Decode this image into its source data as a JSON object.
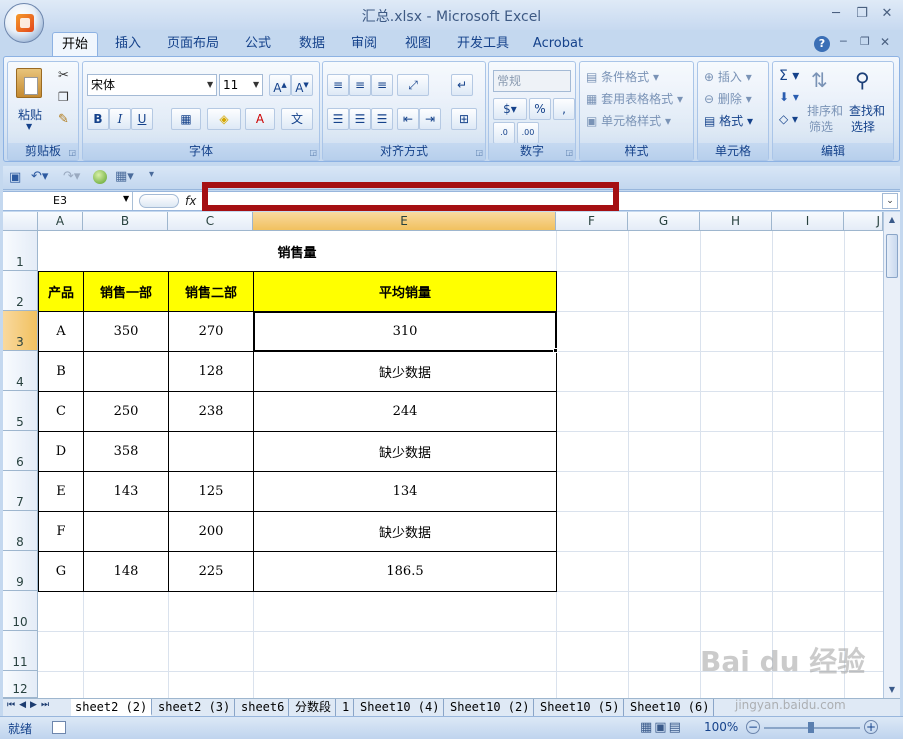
{
  "window": {
    "title": "汇总.xlsx - Microsoft Excel"
  },
  "tabs": [
    "开始",
    "插入",
    "页面布局",
    "公式",
    "数据",
    "审阅",
    "视图",
    "开发工具",
    "Acrobat"
  ],
  "ribbon": {
    "clipboard": {
      "label": "剪贴板",
      "paste": "粘贴"
    },
    "font": {
      "label": "字体",
      "name": "宋体",
      "size": "11"
    },
    "alignment": {
      "label": "对齐方式"
    },
    "number": {
      "label": "数字",
      "format": "常规"
    },
    "styles": {
      "label": "样式",
      "conditional": "条件格式",
      "table": "套用表格格式",
      "cell": "单元格样式"
    },
    "cells": {
      "label": "单元格",
      "insert": "插入",
      "delete": "删除",
      "format": "格式"
    },
    "editing": {
      "label": "编辑",
      "sort": "排序和",
      "filter": "筛选",
      "find": "查找和",
      "select": "选择"
    }
  },
  "formula_bar": {
    "name_box": "E3",
    "fx": "fx",
    "content": ""
  },
  "columns": [
    "A",
    "B",
    "C",
    "E",
    "F",
    "G",
    "H",
    "I",
    "J"
  ],
  "rows": [
    "1",
    "2",
    "3",
    "4",
    "5",
    "6",
    "7",
    "8",
    "9",
    "10",
    "11",
    "12"
  ],
  "sheet": {
    "title": "销售量",
    "headers": [
      "产品",
      "销售一部",
      "销售二部",
      "平均销量"
    ],
    "data": [
      [
        "A",
        "350",
        "270",
        "310"
      ],
      [
        "B",
        "",
        "128",
        "缺少数据"
      ],
      [
        "C",
        "250",
        "238",
        "244"
      ],
      [
        "D",
        "358",
        "",
        "缺少数据"
      ],
      [
        "E",
        "143",
        "125",
        "134"
      ],
      [
        "F",
        "",
        "200",
        "缺少数据"
      ],
      [
        "G",
        "148",
        "225",
        "186.5"
      ]
    ]
  },
  "sheet_tabs": [
    "sheet2 (2)",
    "sheet2 (3)",
    "sheet6",
    "分数段",
    "1",
    "Sheet10 (4)",
    "Sheet10 (2)",
    "Sheet10 (5)",
    "Sheet10 (6)"
  ],
  "status": {
    "ready": "就绪",
    "zoom": "100%"
  },
  "watermark": {
    "brand": "Bai du 经验",
    "url": "jingyan.baidu.com"
  },
  "colors": {
    "header_fill": "#ffff00",
    "highlight_border": "#a50f12",
    "selected_header": "#f1c15f"
  }
}
